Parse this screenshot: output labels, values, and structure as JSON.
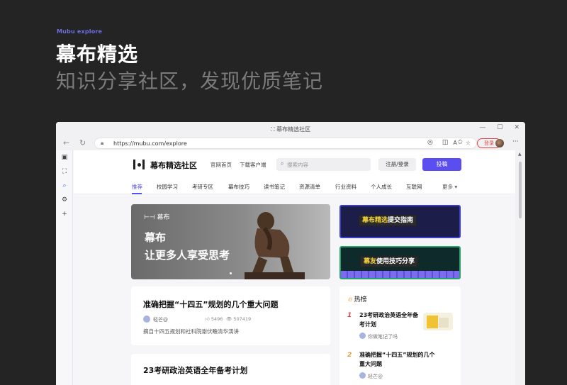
{
  "promo": {
    "kicker": "Mubu explore",
    "title": "幕布精选",
    "subtitle": "知识分享社区，发现优质笔记"
  },
  "browser": {
    "tab_title": "幕布精选社区",
    "url": "https://mubu.com/explore",
    "login_label": "登录",
    "window_controls": [
      "—",
      "☐",
      "✕"
    ]
  },
  "site": {
    "name": "幕布精选社区",
    "header_links": [
      "官网首页",
      "下载客户端"
    ],
    "search_placeholder": "搜索内容",
    "register_label": "注册/登录",
    "post_label": "投稿"
  },
  "categories": {
    "items": [
      "推荐",
      "校园学习",
      "考研专区",
      "幕布技巧",
      "读书笔记",
      "资源清单",
      "行业资料",
      "个人成长",
      "互联网"
    ],
    "active": "推荐",
    "more": "更多 ▾"
  },
  "banner": {
    "logo_text": "幕布",
    "line1": "幕布",
    "line2": "让更多人享受思考"
  },
  "side_promos": [
    {
      "highlight": "幕布精选",
      "rest": "提交指南"
    },
    {
      "highlight": "幕友",
      "rest": "使用技巧分享"
    }
  ],
  "feed": [
    {
      "title": "准确把握“十四五”规划的几个重大问题",
      "author": "轻芒@",
      "likes": "5496",
      "views": "507419",
      "excerpt": "摘自十四五规划和社科院谢伏瞻清华演讲"
    },
    {
      "title": "23考研政治英语全年备考计划"
    }
  ],
  "hot": {
    "heading": "热榜",
    "items": [
      {
        "rank": "1",
        "title": "23考研政治英语全年备考计划",
        "user": "你做笔记了吗",
        "rank_color": "#e04646"
      },
      {
        "rank": "2",
        "title": "准确把握“十四五”规划的几个重大问题",
        "user": "轻芒@",
        "rank_color": "#e6a23c"
      }
    ]
  },
  "colors": {
    "accent": "#5b4ef0",
    "kicker": "#6d6ee0",
    "login": "#e04646"
  }
}
